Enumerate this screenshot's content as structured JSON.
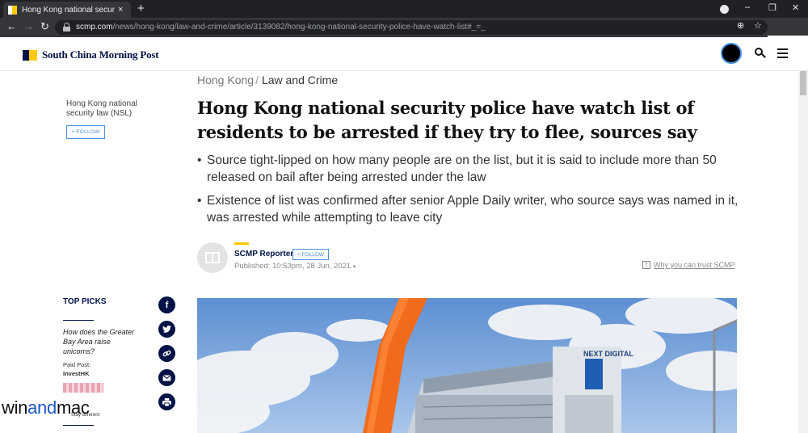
{
  "browser": {
    "tab_title": "Hong Kong national security poli",
    "tab_close": "×",
    "new_tab": "+",
    "url_domain": "scmp.com",
    "url_path": "/news/hong-kong/law-and-crime/article/3139082/hong-kong-national-security-police-have-watch-list#_=_"
  },
  "site": {
    "brand": "South China Morning Post",
    "brand_colors": {
      "navy": "#001246",
      "yellow": "#ffca05"
    }
  },
  "sidebar": {
    "topic": "Hong Kong national security law (NSL)",
    "follow_label": "+ FOLLOW",
    "top_picks_heading": "TOP PICKS",
    "pick_question": "How does the Greater Bay Area raise unicorns?",
    "paid_post_label": "Paid Post:",
    "paid_post_sponsor": "InvestHK",
    "share_icons": [
      "facebook-icon",
      "twitter-icon",
      "link-icon",
      "email-icon",
      "print-icon"
    ]
  },
  "watermark": {
    "win": "win",
    "and": "and",
    "mac": "mac",
    "tagline": "Stay different"
  },
  "article": {
    "crumb_region": "Hong Kong",
    "crumb_sep": "/",
    "crumb_section": "Law and Crime",
    "headline": "Hong Kong national security police have watch list of residents to be arrested if they try to flee, sources say",
    "bullets": [
      "Source tight-lipped on how many people are on the list, but it is said to include more than 50 released on bail after being arrested under the law",
      "Existence of list was confirmed after senior Apple Daily writer, who source says was named in it, was arrested while attempting to leave city"
    ],
    "author": "SCMP Reporter",
    "author_follow": "+ FOLLOW",
    "published": "Published: 10:53pm, 28 Jun, 2021",
    "trust_link": "Why you can trust SCMP",
    "hero_sign": "NEXT DIGITAL"
  }
}
